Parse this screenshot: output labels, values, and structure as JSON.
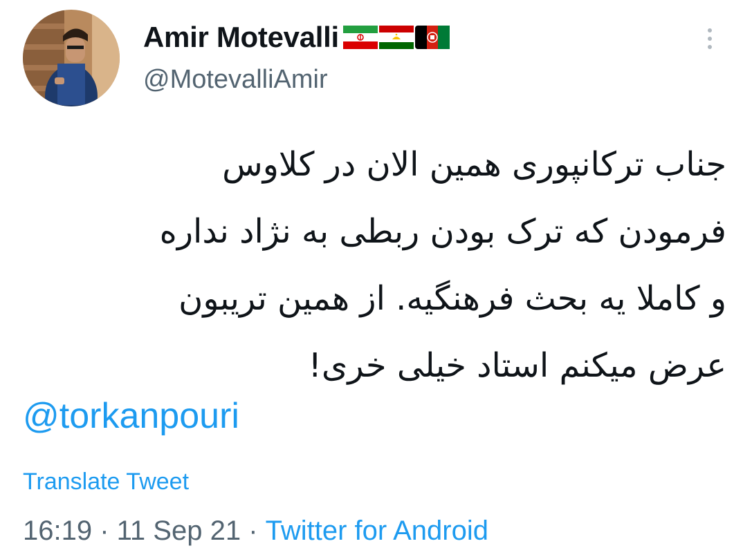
{
  "user": {
    "display_name": "Amir Motevalli",
    "handle": "@MotevalliAmir",
    "flags": [
      "iran-flag-icon",
      "tajikistan-flag-icon",
      "afghanistan-flag-icon"
    ]
  },
  "tweet": {
    "lines": [
      "جناب ترکانپوری همین الان در کلاوس",
      "فرمودن که ترک بودن ربطی به نژاد نداره",
      "و کاملا یه بحث فرهنگیه. از همین تریبون",
      "عرض میکنم استاد خیلی خری!"
    ],
    "mention": "@torkanpouri",
    "translate_label": "Translate Tweet",
    "time": "16:19",
    "separator": " · ",
    "date": "11 Sep 21",
    "source": "Twitter for Android"
  },
  "colors": {
    "link": "#1d9bf0",
    "secondary_text": "#536471",
    "primary_text": "#0f1419"
  },
  "icons": {
    "more": "more-vertical-icon"
  }
}
